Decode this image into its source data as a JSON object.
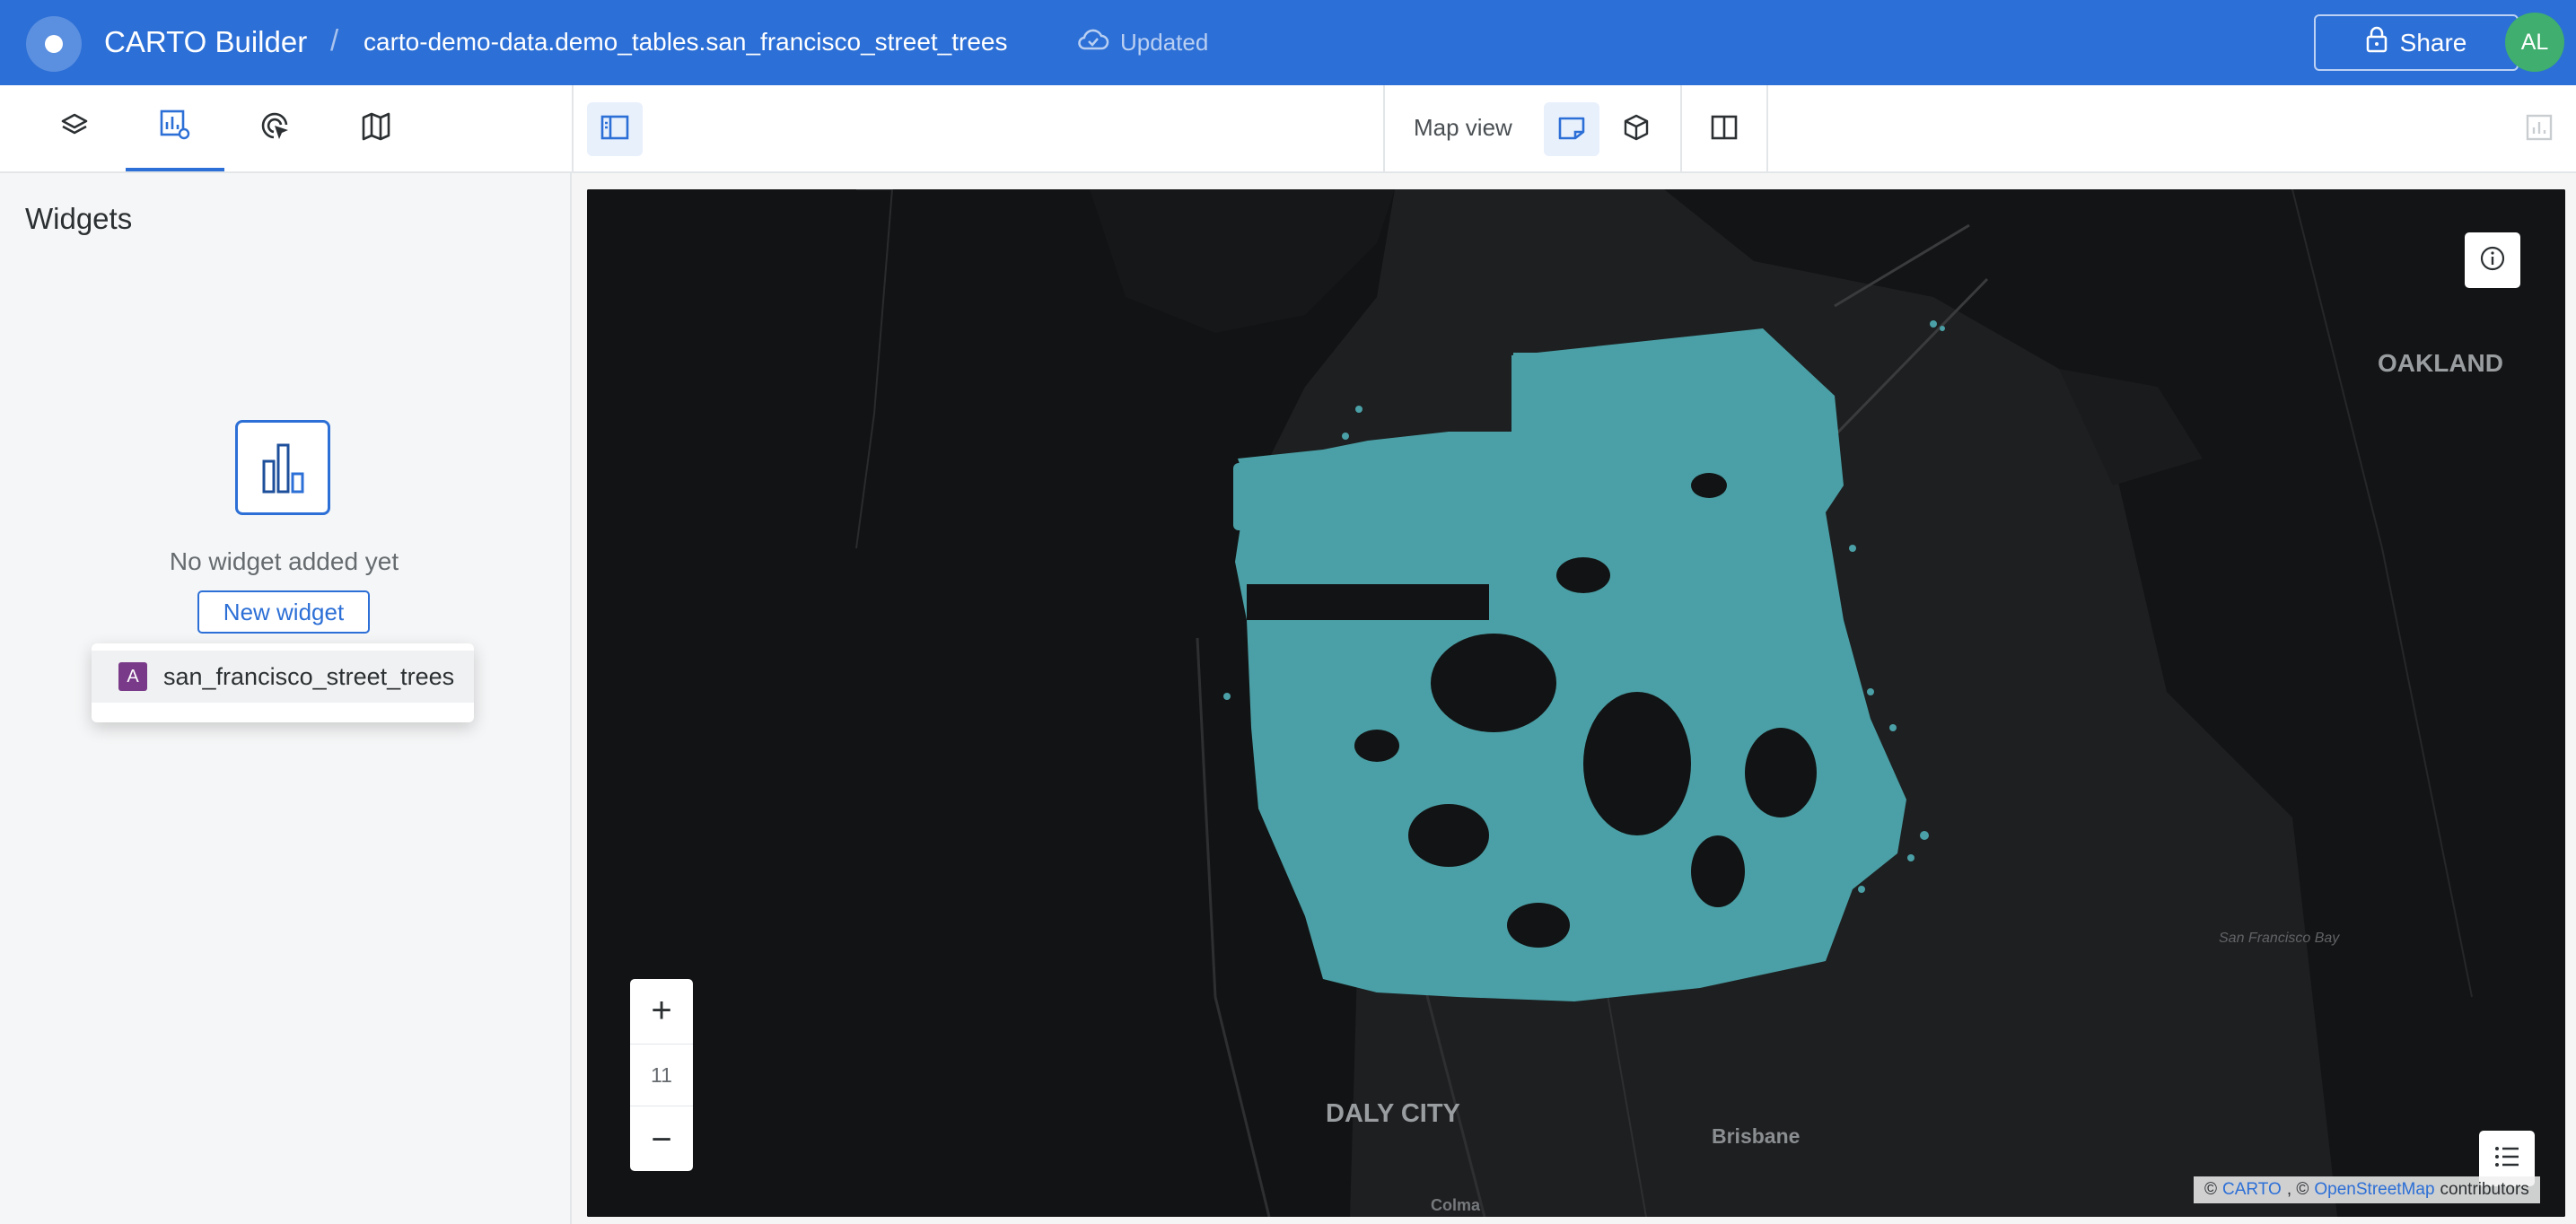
{
  "header": {
    "app_title": "CARTO Builder",
    "separator": "/",
    "dataset": "carto-demo-data.demo_tables.san_francisco_street_trees",
    "status": "Updated",
    "share_label": "Share",
    "avatar_initials": "AL"
  },
  "toolbar": {
    "tabs": [
      {
        "icon": "layers-icon",
        "active": false
      },
      {
        "icon": "widgets-icon",
        "active": true
      },
      {
        "icon": "interactions-icon",
        "active": false
      },
      {
        "icon": "basemap-icon",
        "active": false
      }
    ],
    "map_view_label": "Map view"
  },
  "left_panel": {
    "title": "Widgets",
    "empty_text": "No widget added yet",
    "new_widget_label": "New widget",
    "dropdown": {
      "source_badge": "A",
      "source_name": "san_francisco_street_trees"
    }
  },
  "map": {
    "labels": {
      "oakland": "OAKLAND",
      "daly_city": "DALY CITY",
      "brisbane": "Brisbane",
      "colma": "Colma",
      "sf_bay": "San Francisco Bay"
    },
    "zoom_level": "11",
    "zoom_in": "+",
    "zoom_out": "−",
    "attribution": {
      "prefix": "©",
      "carto": "CARTO",
      "sep": ", ©",
      "osm": "OpenStreetMap",
      "suffix": "contributors"
    },
    "point_color": "#4aa0a6",
    "land_color": "#121314",
    "water_color": "#1e1f21"
  },
  "colors": {
    "brand": "#2c6fd6",
    "avatar": "#3fae6e",
    "source_badge": "#7a3a8a"
  }
}
